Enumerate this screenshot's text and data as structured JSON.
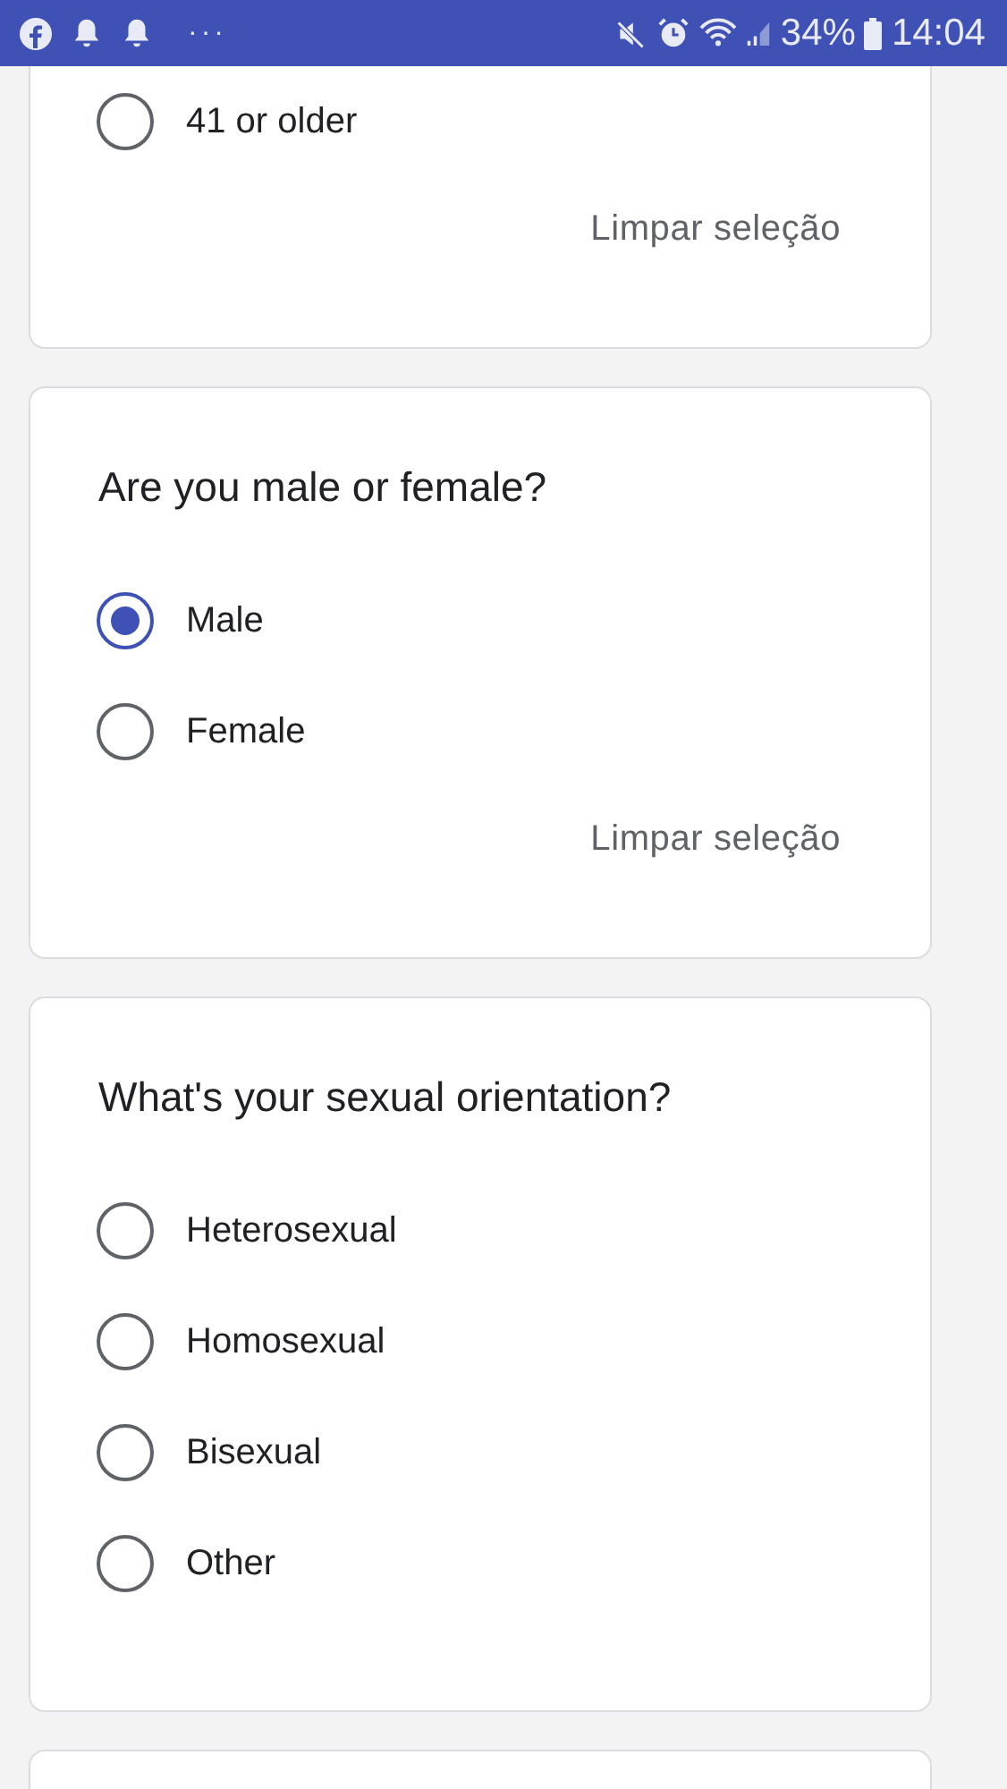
{
  "status_bar": {
    "battery": "34%",
    "time": "14:04",
    "more": "···"
  },
  "cards": [
    {
      "cut_top": true,
      "options": [
        {
          "label": "41 or older",
          "selected": false
        }
      ],
      "clear_label": "Limpar seleção"
    },
    {
      "question": "Are you male or female?",
      "options": [
        {
          "label": "Male",
          "selected": true
        },
        {
          "label": "Female",
          "selected": false
        }
      ],
      "clear_label": "Limpar seleção"
    },
    {
      "question": "What's your sexual orientation?",
      "options": [
        {
          "label": "Heterosexual",
          "selected": false
        },
        {
          "label": "Homosexual",
          "selected": false
        },
        {
          "label": "Bisexual",
          "selected": false
        },
        {
          "label": "Other",
          "selected": false
        }
      ]
    },
    {
      "cut_bottom": true
    }
  ]
}
